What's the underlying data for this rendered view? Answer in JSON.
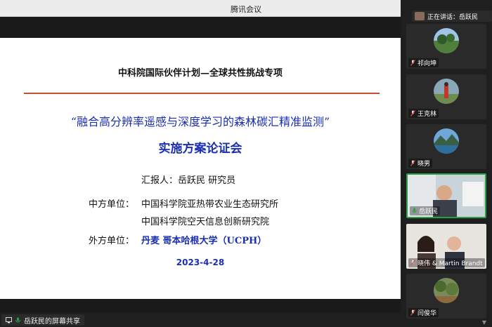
{
  "window": {
    "title": "腾讯会议"
  },
  "speaking": {
    "prefix": "正在讲话：",
    "name": "岳跃民"
  },
  "participants": [
    {
      "name": "祁向坤",
      "icon": "landscape-avatar"
    },
    {
      "name": "王克林",
      "icon": "person-avatar"
    },
    {
      "name": "晓男",
      "icon": "lake-avatar"
    },
    {
      "name": "岳跃民",
      "icon": "camera-video"
    },
    {
      "name": "晓伟 & Martin Brandt",
      "icon": "camera-video"
    },
    {
      "name": "闫俊华",
      "icon": "forest-avatar"
    }
  ],
  "slide": {
    "subtitle": "中科院国际伙伴计划—全球共性挑战专项",
    "title_line1": "“融合高分辨率遥感与深度学习的森林碳汇精准监测”",
    "title_line2": "实施方案论证会",
    "reporter": "汇报人：岳跃民 研究员",
    "cn_units_label": "中方单位：",
    "cn_unit_1": "中国科学院亚热带农业生态研究所",
    "cn_unit_2": "中国科学院空天信息创新研究院",
    "foreign_label": "外方单位：",
    "foreign_unit": "丹麦  哥本哈根大学（UCPH）",
    "date": "2023-4-28"
  },
  "bottom": {
    "share_label": "岳跃民的屏幕共享"
  },
  "colors": {
    "accent_blue": "#1a2fb0",
    "rule": "#c0522c",
    "active_border": "#2ea043"
  }
}
